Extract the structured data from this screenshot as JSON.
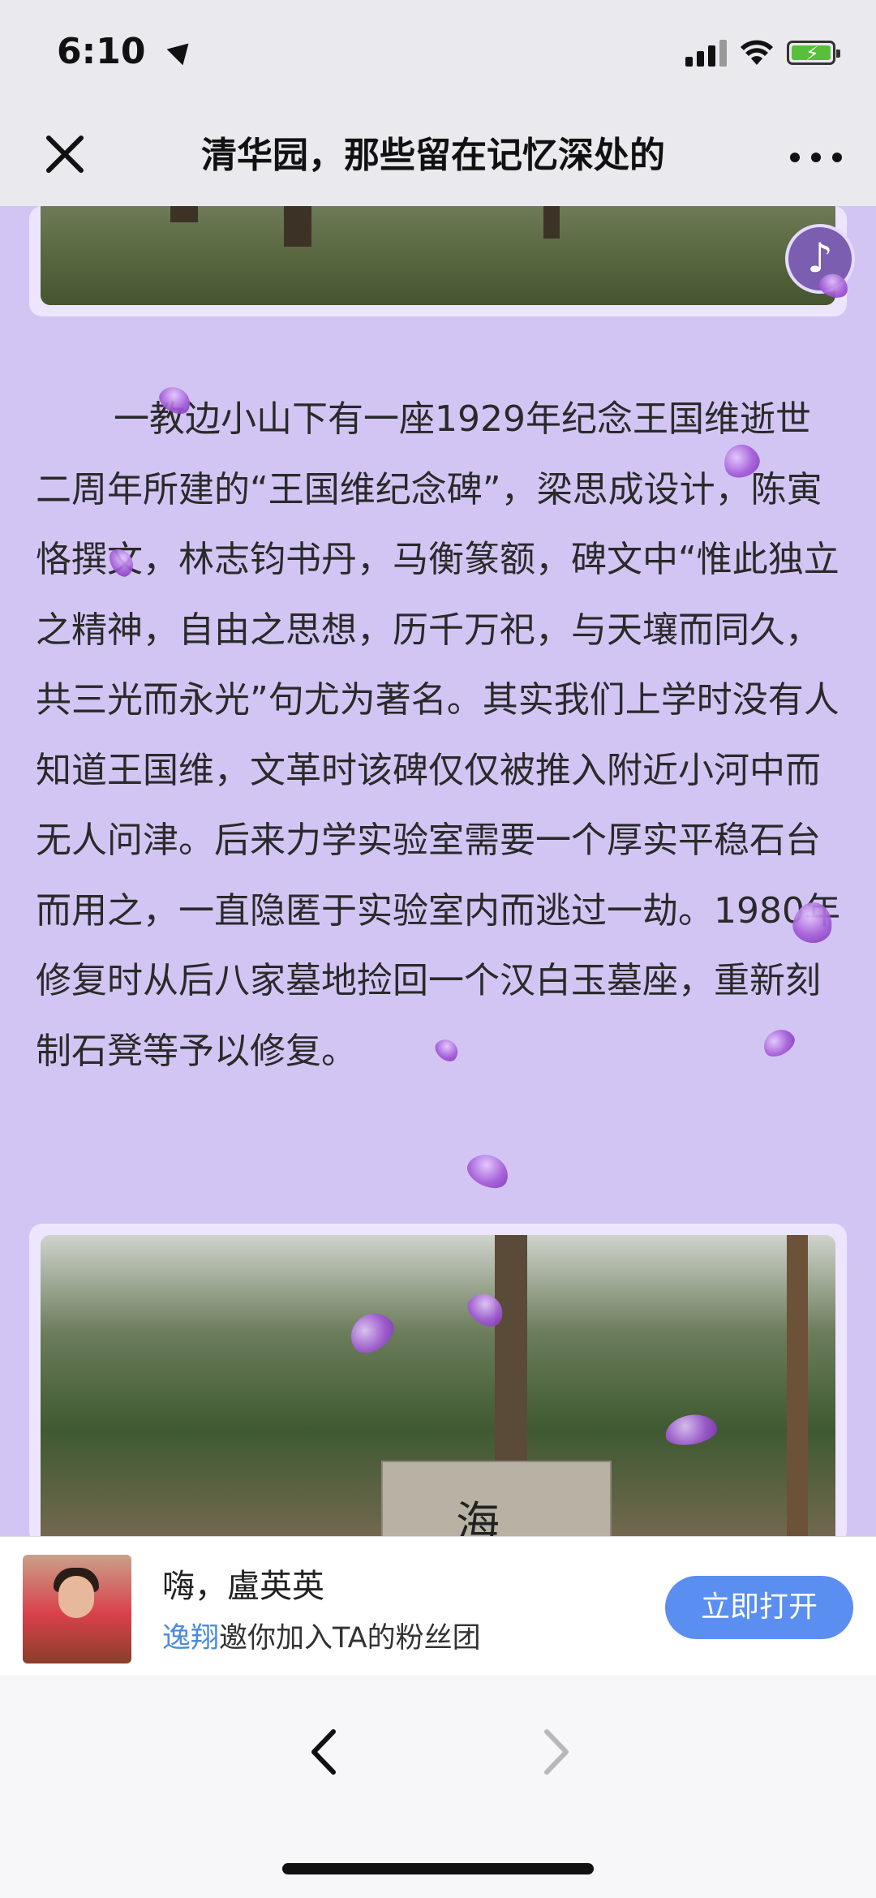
{
  "status_bar": {
    "time": "6:10"
  },
  "navbar": {
    "title": "清华园，那些留在记忆深处的"
  },
  "article": {
    "text": "一教边小山下有一座1929年纪念王国维逝世二周年所建的“王国维纪念碑”，梁思成设计，陈寅恪撰文，林志钧书丹，马衡篆额，碑文中“惟此独立之精神，自由之思想，历千万祀，与天壤而同久，共三光而永光”句尤为著名。其实我们上学时没有人知道王国维，文革时该碑仅仅被推入附近小河中而无人问津。后来力学实验室需要一个厚实平稳石台而用之，一直隐匿于实验室内而逃过一劫。1980年修复时从后八家墓地捡回一个汉白玉墓座，重新刻制石凳等予以修复。"
  },
  "photo_bottom": {
    "stele_char": "海"
  },
  "banner": {
    "greeting": "嗨，盧英英",
    "inviter": "逸翔",
    "invite_text": "邀你加入TA的粉丝团",
    "button_label": "立即打开"
  },
  "colors": {
    "background": "#d3c5f3",
    "button": "#5a8ef0",
    "link": "#4a8ae0"
  }
}
